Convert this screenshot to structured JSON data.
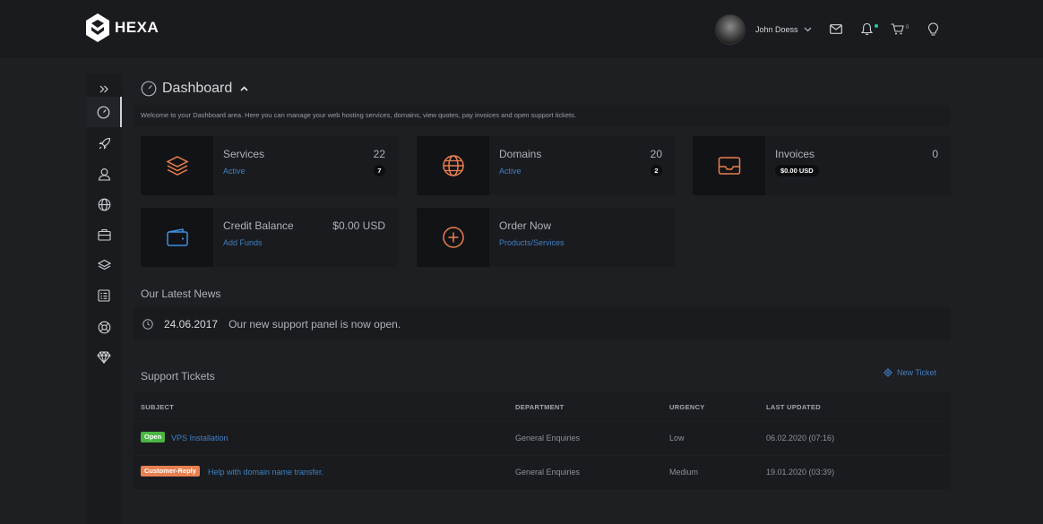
{
  "brand": {
    "name": "HEXA"
  },
  "header": {
    "user_name": "John Doess",
    "cart_count": "0"
  },
  "page": {
    "title": "Dashboard",
    "welcome": "Welcome to your Dashboard area. Here you can manage your web  hosting services, domains, view quotes, pay invoices and open support   tickets."
  },
  "tiles": [
    {
      "label": "Services",
      "sub": "Active",
      "count": "22",
      "pill": "7"
    },
    {
      "label": "Domains",
      "sub": "Active",
      "count": "20",
      "pill": "2"
    },
    {
      "label": "Invoices",
      "sub": "",
      "count": "0",
      "pill": "$0.00 USD"
    },
    {
      "label": "Credit Balance",
      "sub": "Add Funds",
      "count": "$0.00 USD",
      "pill": ""
    },
    {
      "label": "Order Now",
      "sub": "Products/Services",
      "count": "",
      "pill": ""
    }
  ],
  "news": {
    "title": "Our Latest News",
    "items": [
      {
        "date": "24.06.2017",
        "text": "Our new support panel is now open."
      }
    ]
  },
  "tickets": {
    "title": "Support Tickets",
    "new_ticket": "New Ticket",
    "columns": [
      "SUBJECT",
      "DEPARTMENT",
      "URGENCY",
      "LAST UPDATED"
    ],
    "rows": [
      {
        "status": "Open",
        "subject": "VPS Installation",
        "department": "General Enquiries",
        "urgency": "Low",
        "updated": "06.02.2020 (07:16)"
      },
      {
        "status": "Customer-Reply",
        "subject": "Help with domain name transfer.",
        "department": "General Enquiries",
        "urgency": "Medium",
        "updated": "19.01.2020 (03:39)"
      }
    ]
  },
  "icons": {
    "sidebar": [
      "expand-icon",
      "dashboard-icon",
      "rocket-icon",
      "user-icon",
      "globe-icon",
      "briefcase-icon",
      "layers-icon",
      "invoice-icon",
      "support-icon",
      "diamond-icon"
    ],
    "header": [
      "mail-icon",
      "bell-icon",
      "cart-icon",
      "lightbulb-icon"
    ]
  },
  "colors": {
    "accent_orange": "#e9804f",
    "link_blue": "#3f80c1",
    "status_open": "#4bb543",
    "notification": "#2ec4a5"
  }
}
